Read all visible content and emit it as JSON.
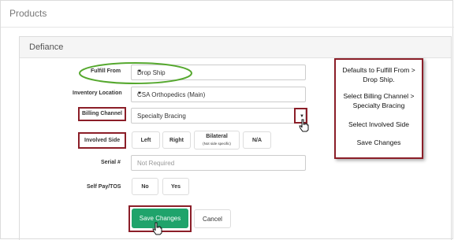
{
  "header": {
    "title": "Products"
  },
  "panel": {
    "title": "Defiance"
  },
  "form": {
    "fulfill_from": {
      "label": "Fulfill From",
      "value": "Drop Ship"
    },
    "inventory_location": {
      "label": "Inventory Location",
      "value": "CSA Orthopedics (Main)"
    },
    "billing_channel": {
      "label": "Billing Channel",
      "value": "Specialty Bracing"
    },
    "involved_side": {
      "label": "Involved Side",
      "options": {
        "left": "Left",
        "right": "Right",
        "bilateral": "Bilateral",
        "bilateral_sub": "(Not side specific)",
        "na": "N/A"
      }
    },
    "serial": {
      "label": "Serial #",
      "placeholder": "Not Required"
    },
    "self_pay": {
      "label": "Self Pay/TOS",
      "options": {
        "no": "No",
        "yes": "Yes"
      }
    }
  },
  "actions": {
    "save": "Save Changes",
    "cancel": "Cancel"
  },
  "instructions": [
    "Defaults to Fulfill From > Drop Ship.",
    "Select Billing Channel > Specialty Bracing",
    "Select Involved Side",
    "Save Changes"
  ],
  "colors": {
    "accent_green": "#1fa36b",
    "annotation_red": "#8b1e28",
    "highlight_green": "#55a82e"
  },
  "icons": {
    "dropdown": "caret-down-icon",
    "cursor": "hand-pointer-icon"
  }
}
